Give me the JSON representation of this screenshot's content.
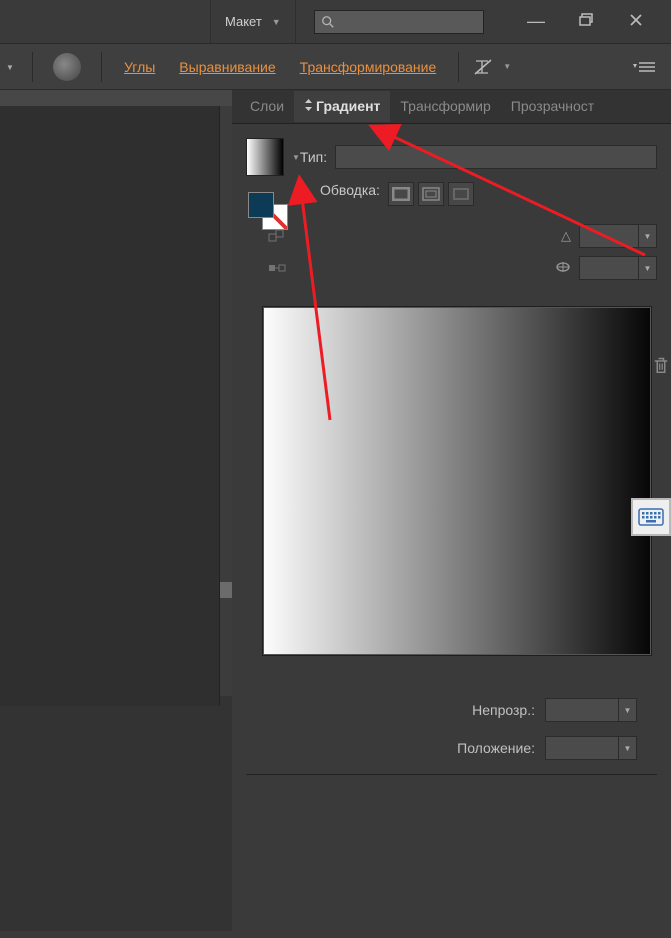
{
  "titlebar": {
    "layout_label": "Макет"
  },
  "toolbar": {
    "links": {
      "corners": "Углы",
      "align": "Выравнивание",
      "transform": "Трансформирование"
    }
  },
  "panel": {
    "tabs": {
      "layers": "Слои",
      "gradient": "Градиент",
      "transform": "Трансформир",
      "opacity": "Прозрачност"
    },
    "labels": {
      "type": "Тип:",
      "stroke": "Обводка:",
      "opacity": "Непрозр.:",
      "position": "Положение:"
    },
    "values": {
      "type": "",
      "angle": "",
      "ratio": "",
      "opacity": "",
      "position": ""
    }
  },
  "colors": {
    "accent": "#e89040",
    "fill_swatch": "#0d3a55"
  }
}
